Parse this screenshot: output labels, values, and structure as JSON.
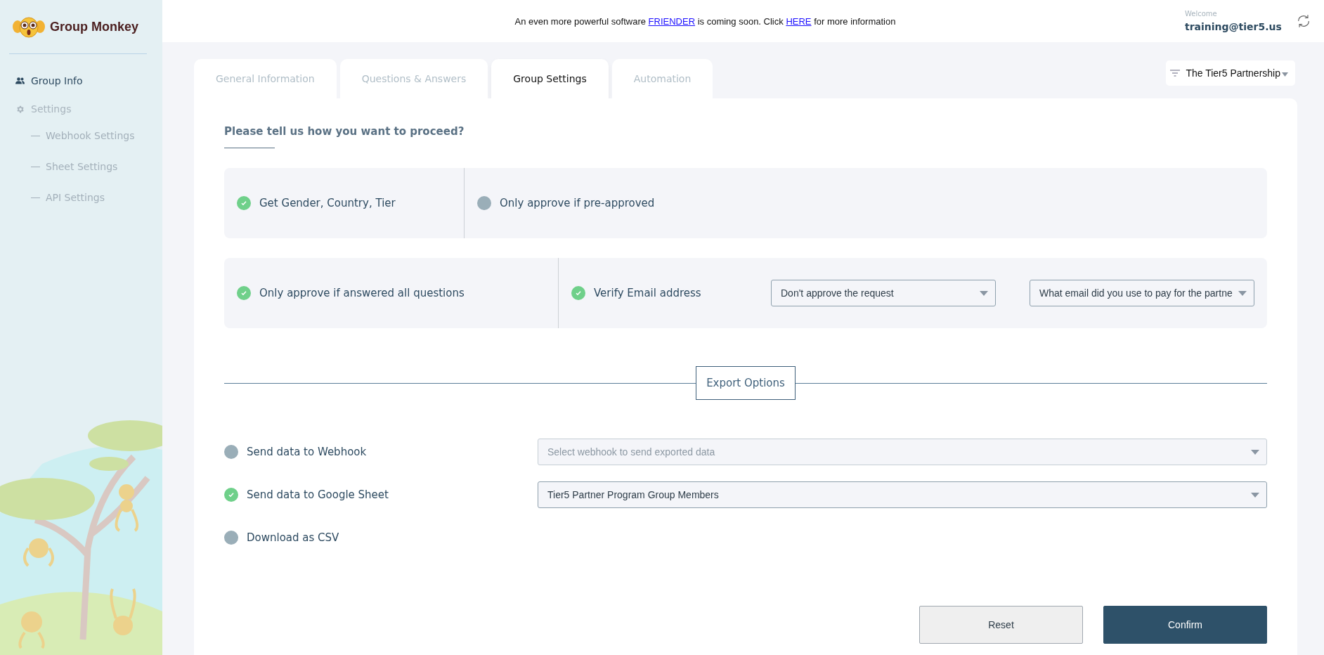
{
  "brand": {
    "name": "Group Monkey"
  },
  "sidebar": {
    "items": [
      {
        "label": "Group Info",
        "selected": true
      },
      {
        "label": "Settings",
        "selected": false,
        "children": [
          {
            "label": "Webhook Settings",
            "selected": false
          },
          {
            "label": "Sheet Settings",
            "selected": false
          },
          {
            "label": "API Settings",
            "selected": false
          }
        ]
      }
    ]
  },
  "announcement": [
    {
      "kind": "text",
      "text": "An even more powerful software"
    },
    {
      "kind": "link",
      "text": "FRIENDER"
    },
    {
      "kind": "text",
      "text": "is coming soon. Click"
    },
    {
      "kind": "link",
      "text": "HERE"
    },
    {
      "kind": "text",
      "text": "for more information"
    }
  ],
  "user": {
    "greeting": "Welcome",
    "email": "training@tier5.us"
  },
  "tabs": [
    {
      "label": "General Information",
      "selected": false
    },
    {
      "label": "Questions & Answers",
      "selected": false
    },
    {
      "label": "Group Settings",
      "selected": true
    },
    {
      "label": "Automation",
      "selected": false
    }
  ],
  "group_picker": {
    "value": "The Tier5 Partnership"
  },
  "heading": "Please tell us how you want to proceed?",
  "option_panels": [
    {
      "options": [
        {
          "label": "Get Gender, Country, Tier",
          "checked": true
        },
        {
          "label": "Only approve if pre-approved",
          "checked": false
        }
      ]
    },
    {
      "options": [
        {
          "label": "Only approve if answered all questions",
          "checked": true
        },
        {
          "label": "Verify Email address",
          "checked": true,
          "selects": [
            {
              "value": "Don't approve the request"
            },
            {
              "value": "What email did you use to pay for the partne"
            }
          ]
        }
      ]
    }
  ],
  "export": {
    "title": "Export Options",
    "rows": [
      {
        "label": "Send data to Webhook",
        "checked": false,
        "select": {
          "placeholder": "Select webhook to send exported data"
        }
      },
      {
        "label": "Send data to Google Sheet",
        "checked": true,
        "select": {
          "value": "Tier5 Partner Program Group Members"
        }
      },
      {
        "label": "Download as CSV",
        "checked": false
      }
    ]
  },
  "buttons": [
    {
      "label": "Reset",
      "kind": "secondary"
    },
    {
      "label": "Confirm",
      "kind": "primary"
    }
  ]
}
